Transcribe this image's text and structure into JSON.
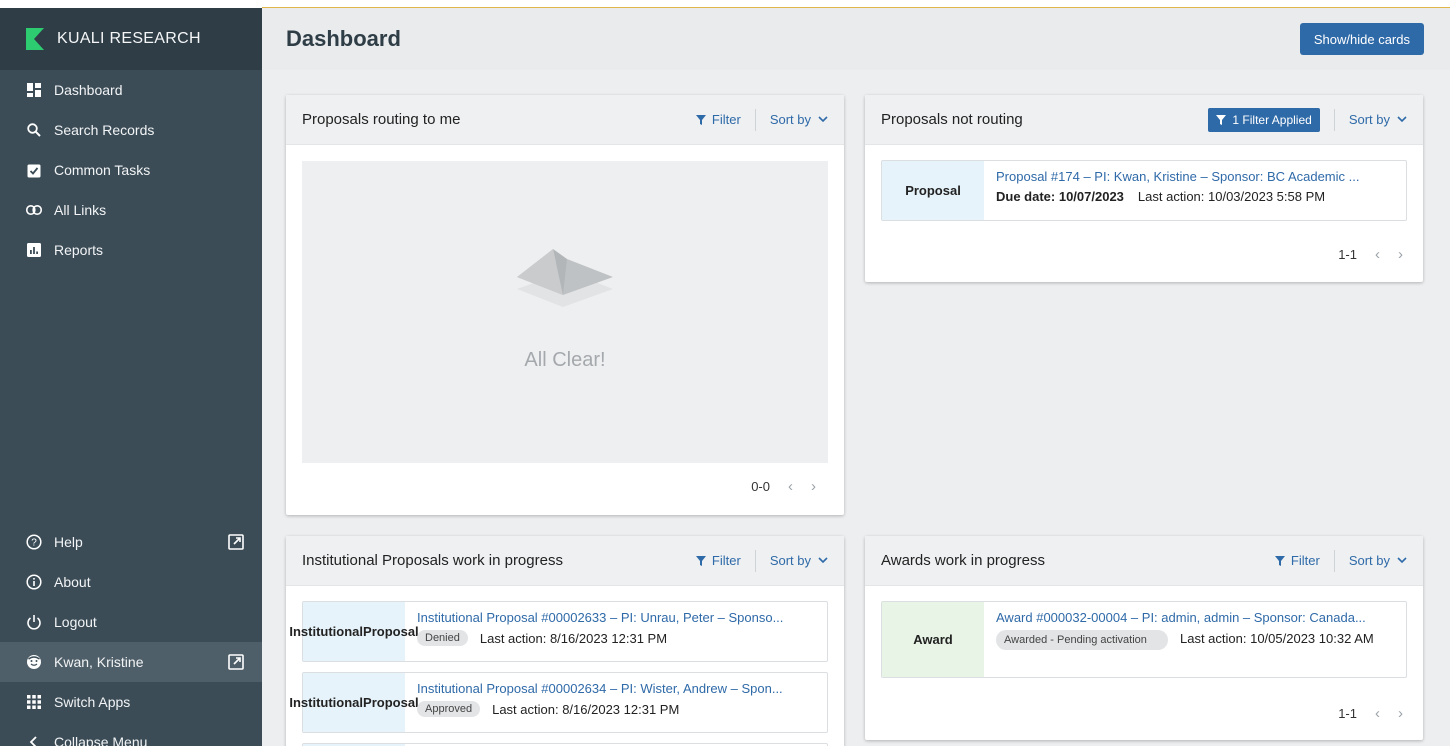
{
  "brand": {
    "name": "KUALI RESEARCH",
    "logo_color": "#2ecc71"
  },
  "sidebar": {
    "items": [
      {
        "label": "Dashboard",
        "icon": "dashboard-icon"
      },
      {
        "label": "Search Records",
        "icon": "search-icon"
      },
      {
        "label": "Common Tasks",
        "icon": "clipboard-check-icon"
      },
      {
        "label": "All Links",
        "icon": "link-icon"
      },
      {
        "label": "Reports",
        "icon": "bar-chart-icon"
      }
    ],
    "bottom": [
      {
        "label": "Help",
        "icon": "help-icon"
      },
      {
        "label": "About",
        "icon": "info-icon"
      },
      {
        "label": "Logout",
        "icon": "power-icon"
      },
      {
        "label": "Kwan, Kristine",
        "icon": "user-face-icon"
      },
      {
        "label": "Switch Apps",
        "icon": "grid-icon"
      },
      {
        "label": "Collapse Menu",
        "icon": "chevron-left-icon"
      }
    ]
  },
  "header": {
    "title": "Dashboard",
    "show_hide_label": "Show/hide cards"
  },
  "common": {
    "filter": "Filter",
    "sort_by": "Sort by"
  },
  "card_routing": {
    "title": "Proposals routing to me",
    "empty_text": "All Clear!",
    "pager": "0-0"
  },
  "card_not_routing": {
    "title": "Proposals not routing",
    "filter_applied": "1 Filter Applied",
    "pager": "1-1",
    "rows": [
      {
        "type": "Proposal",
        "link": "Proposal #174 – PI: Kwan, Kristine – Sponsor: BC Academic ...",
        "due_label": "Due date: 10/07/2023",
        "last_action": "Last action: 10/03/2023 5:58 PM"
      }
    ]
  },
  "card_institutional": {
    "title": "Institutional Proposals work in progress",
    "rows": [
      {
        "type_line1": "Institutional",
        "type_line2": "Proposal",
        "link": "Institutional Proposal #00002633 – PI: Unrau, Peter – Sponso...",
        "status": "Denied",
        "last_action": "Last action: 8/16/2023 12:31 PM"
      },
      {
        "type_line1": "Institutional",
        "type_line2": "Proposal",
        "link": "Institutional Proposal #00002634 – PI: Wister, Andrew – Spon...",
        "status": "Approved",
        "last_action": "Last action: 8/16/2023 12:31 PM"
      }
    ]
  },
  "card_awards": {
    "title": "Awards work in progress",
    "pager": "1-1",
    "rows": [
      {
        "type": "Award",
        "link": "Award #000032-00004 – PI: admin, admin – Sponsor: Canada...",
        "status": "Awarded - Pending activation",
        "last_action": "Last action: 10/05/2023 10:32 AM"
      }
    ]
  },
  "colors": {
    "accent": "#2f6aa8",
    "sidebar": "#3b4c57",
    "brand_bg": "#2f3d46"
  }
}
